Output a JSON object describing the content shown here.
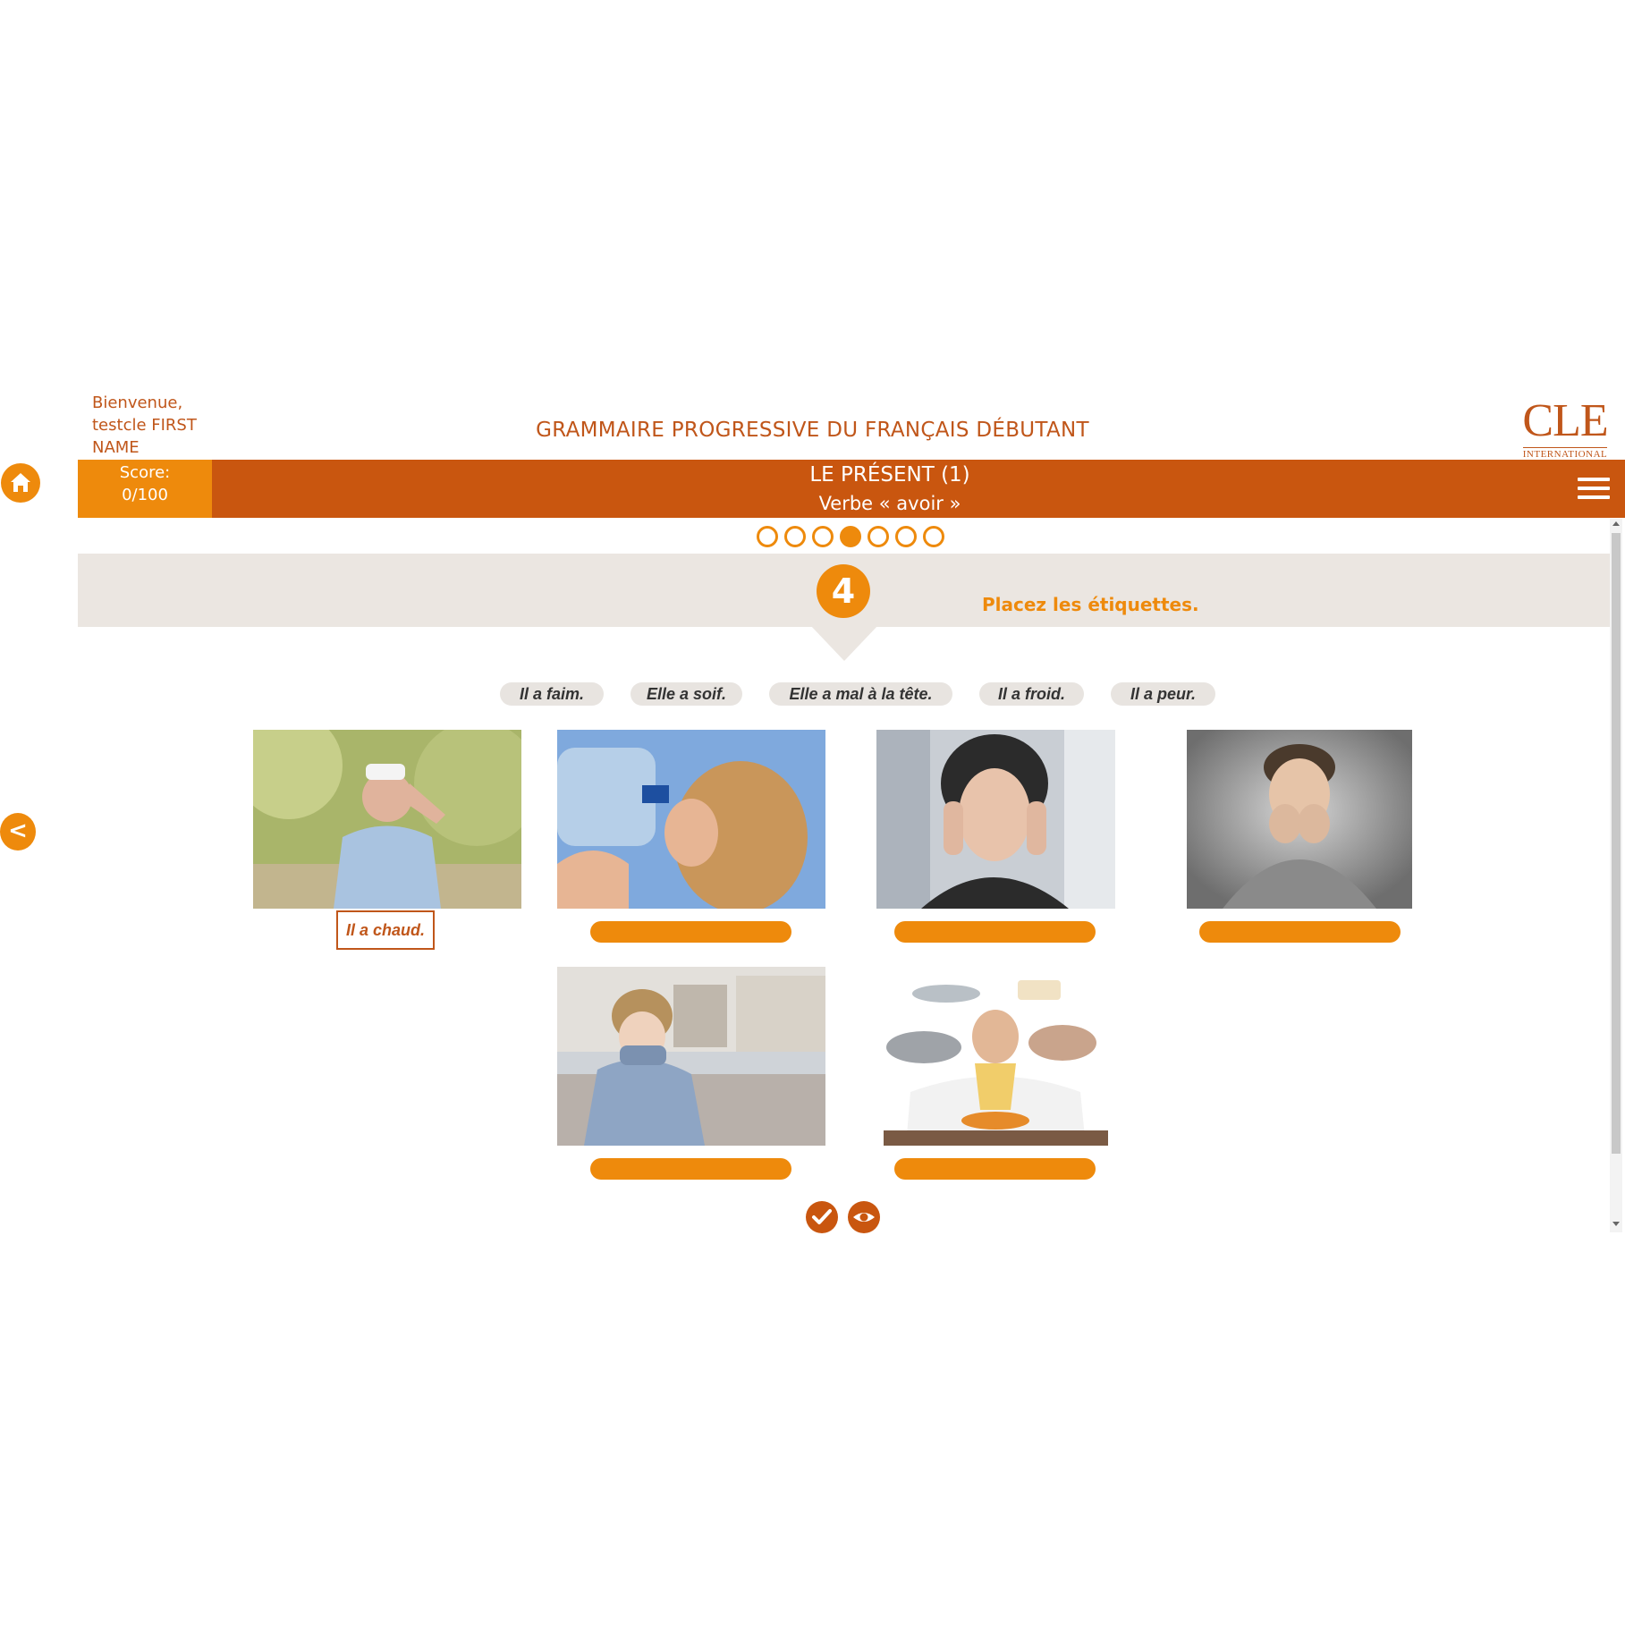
{
  "header": {
    "welcome": "Bienvenue, testcle FIRST NAME",
    "course_title": "GRAMMAIRE PROGRESSIVE DU FRANÇAIS DÉBUTANT",
    "logo_main": "CLE",
    "logo_sub": "INTERNATIONAL"
  },
  "score": {
    "label": "Score:",
    "value": "0/100"
  },
  "lesson": {
    "title": "LE PRÉSENT (1)",
    "subtitle": "Verbe « avoir »"
  },
  "progress": {
    "total": 7,
    "current": 4
  },
  "exercise": {
    "number": "4",
    "instruction": "Placez les étiquettes."
  },
  "labels": [
    "Il a faim.",
    "Elle a soif.",
    "Elle a mal à la tête.",
    "Il a froid.",
    "Il a peur."
  ],
  "placed_label": "Il a chaud.",
  "pictures": [
    {
      "icon": "hot-man-photo"
    },
    {
      "icon": "thirsty-woman-photo"
    },
    {
      "icon": "headache-woman-photo"
    },
    {
      "icon": "scared-boy-photo"
    },
    {
      "icon": "cold-boy-photo"
    },
    {
      "icon": "hungry-man-photo"
    }
  ],
  "colors": {
    "accent": "#ee8a0c",
    "dark_accent": "#c9560f",
    "band": "#ebe6e1",
    "text_brand": "#c0561a"
  }
}
